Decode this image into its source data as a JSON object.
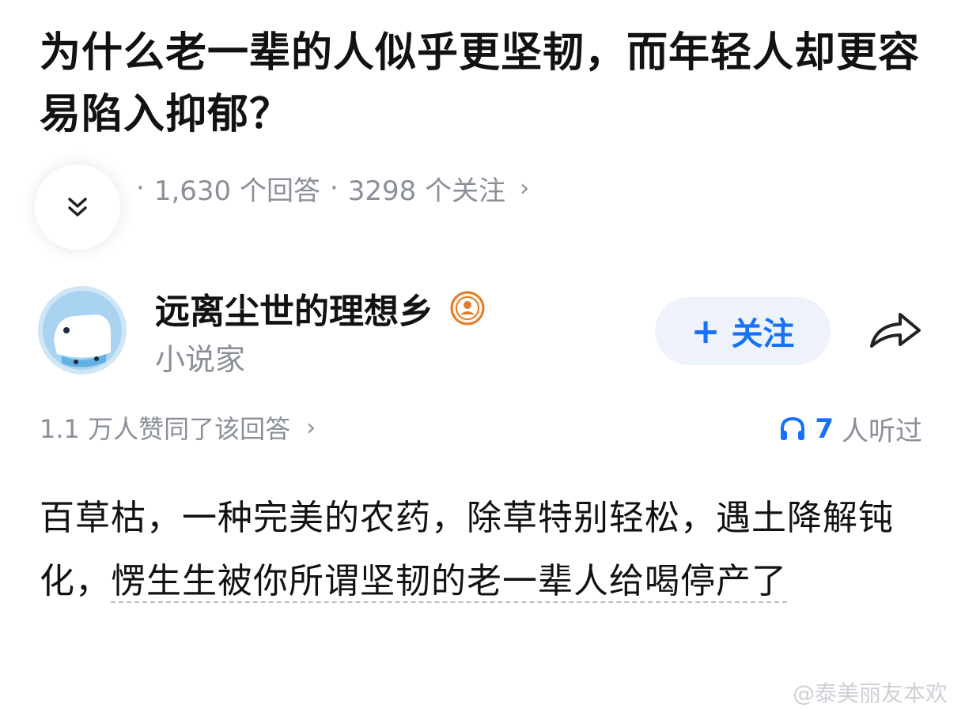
{
  "question": {
    "title": "为什么老一辈的人似乎更坚韧，而年轻人却更容易陷入抑郁？",
    "answers_count": "1,630 个回答",
    "followers_count": "3298 个关注"
  },
  "author": {
    "name": "远离尘世的理想乡",
    "title": "小说家",
    "follow_label": "关注"
  },
  "answer": {
    "likes_text": "1.1 万人赞同了该回答",
    "listen_count": "7",
    "listen_suffix": "人听过",
    "body_text": "百草枯，一种完美的农药，除草特别轻松，遇土降解钝化，",
    "body_highlight": "愣生生被你所谓坚韧的老一辈人给喝停产了"
  },
  "watermark": "@泰美丽友本欢",
  "colors": {
    "accent": "#1772f6",
    "muted": "#8a8f99",
    "follow_bg": "#eef3fb"
  },
  "icons": [
    "chevron-down-double-icon",
    "verified-badge-icon",
    "share-icon",
    "headphones-icon",
    "chevron-right-icon"
  ]
}
